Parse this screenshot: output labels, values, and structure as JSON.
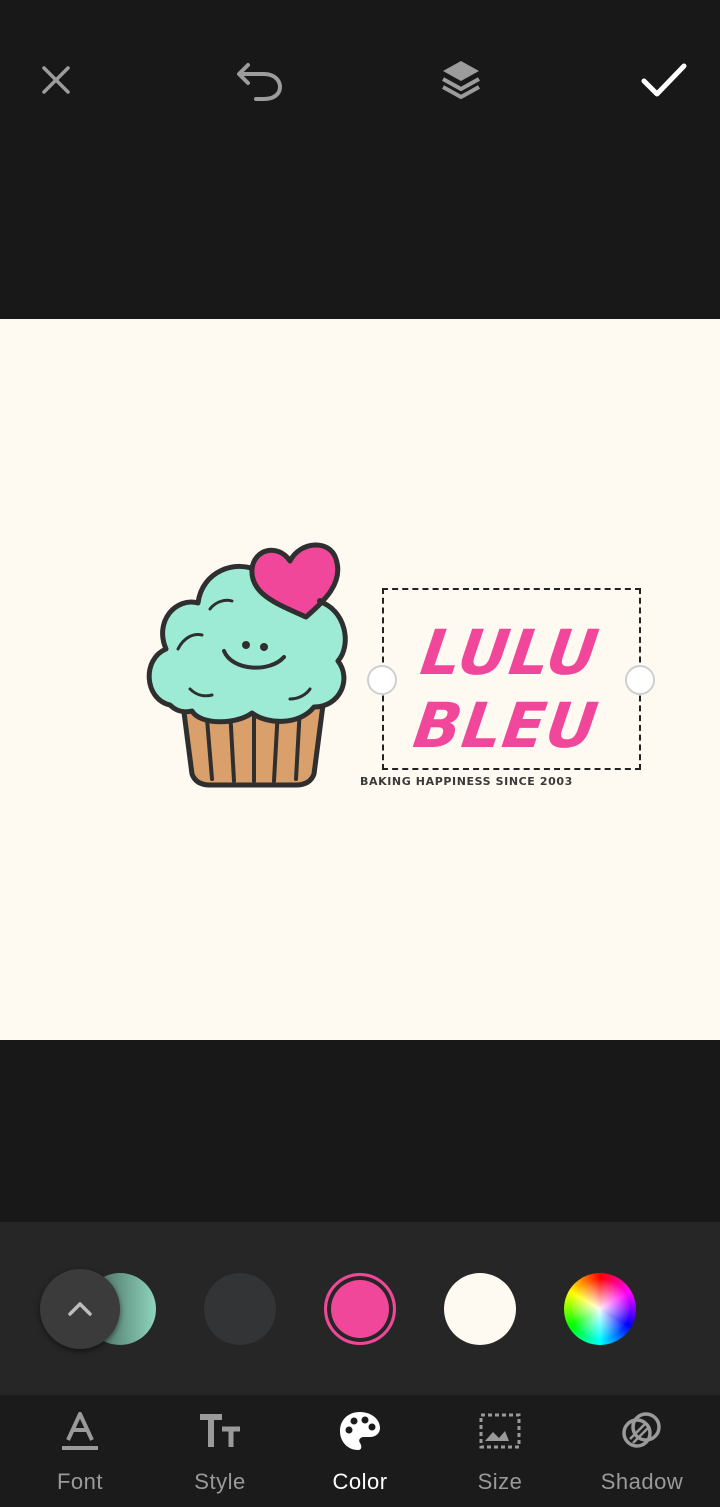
{
  "toolbar": {
    "close_icon": "close-icon",
    "undo_icon": "undo-icon",
    "layers_icon": "layers-icon",
    "confirm_icon": "checkmark-icon"
  },
  "canvas": {
    "background": "#FEF9F1",
    "brand_line_1": "LULU",
    "brand_line_2": "BLEU",
    "brand_color": "#F0479A",
    "tagline": "BAKING HAPPINESS SINCE 2003",
    "illustration": "cupcake-with-heart"
  },
  "color_panel": {
    "swatches": [
      {
        "name": "teal-gradient",
        "color": "#8ed5bd"
      },
      {
        "name": "dark-gray",
        "color": "#333436"
      },
      {
        "name": "pink",
        "color": "#F0479A",
        "selected": true
      },
      {
        "name": "cream",
        "color": "#FEF9F1"
      },
      {
        "name": "custom-color-wheel",
        "color": "rainbow"
      }
    ],
    "expand_icon": "chevron-up-icon"
  },
  "nav": {
    "items": [
      {
        "label": "Font",
        "icon": "font-icon"
      },
      {
        "label": "Style",
        "icon": "text-style-icon"
      },
      {
        "label": "Color",
        "icon": "palette-icon",
        "active": true
      },
      {
        "label": "Size",
        "icon": "size-icon"
      },
      {
        "label": "Shadow",
        "icon": "shadow-icon"
      }
    ]
  }
}
